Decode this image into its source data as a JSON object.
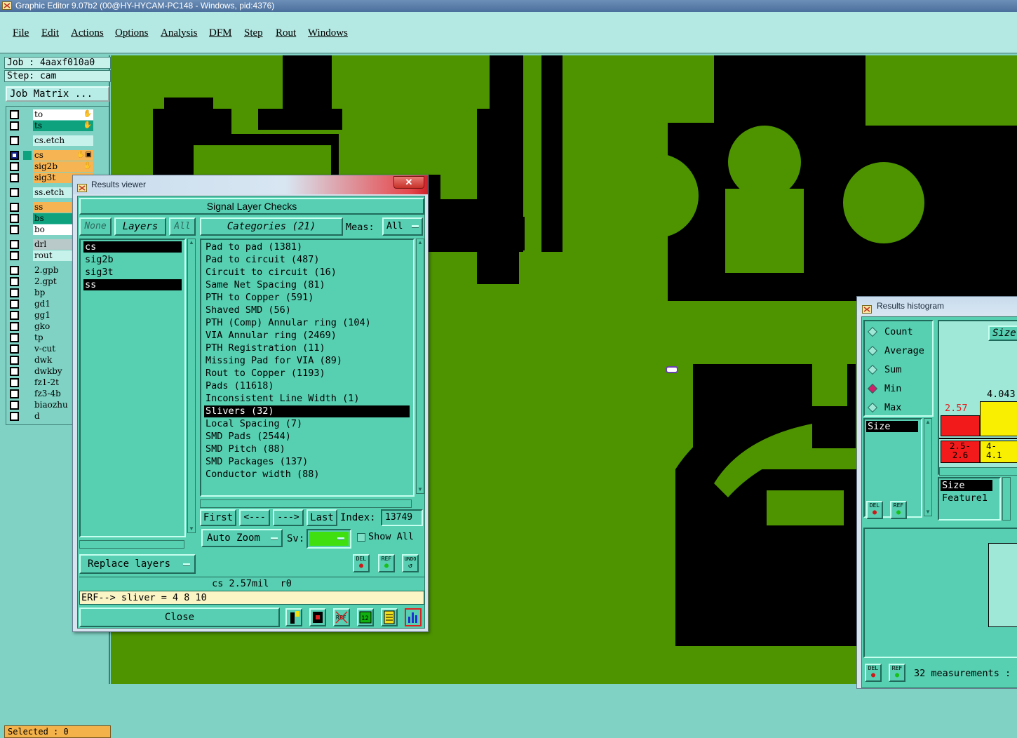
{
  "window": {
    "title": "Graphic Editor 9.07b2 (00@HY-HYCAM-PC148 - Windows, pid:4376)"
  },
  "menu": [
    "File",
    "Edit",
    "Actions",
    "Options",
    "Analysis",
    "DFM",
    "Step",
    "Rout",
    "Windows"
  ],
  "left": {
    "job": "Job : 4aaxf010a0",
    "step": "Step: cam",
    "job_matrix": "Job Matrix ...",
    "selected": "Selected : 0",
    "layers": [
      {
        "name": "to",
        "color": "#ffffff",
        "mark": "✋"
      },
      {
        "name": "ts",
        "color": "#0fa27e",
        "mark": "✋"
      },
      {
        "name": "cs.etch",
        "color": "#c7f2ec",
        "mark": ""
      },
      {
        "name": "cs",
        "color": "#f7b452",
        "mark": "✋▣",
        "selected": true
      },
      {
        "name": "sig2b",
        "color": "#f7b452",
        "mark": "✋"
      },
      {
        "name": "sig3t",
        "color": "#f7b452",
        "mark": ""
      },
      {
        "name": "ss.etch",
        "color": "#c7f2ec",
        "mark": ""
      },
      {
        "name": "ss",
        "color": "#f7b452",
        "mark": ""
      },
      {
        "name": "bs",
        "color": "#0fa27e",
        "mark": ""
      },
      {
        "name": "bo",
        "color": "#ffffff",
        "mark": ""
      },
      {
        "name": "drl",
        "color": "#b9c9c9",
        "mark": ""
      },
      {
        "name": "rout",
        "color": "#c7f2ec",
        "mark": ""
      },
      {
        "name": "2.gpb",
        "color": "#7fd2c4",
        "mark": ""
      },
      {
        "name": "2.gpt",
        "color": "#7fd2c4",
        "mark": ""
      },
      {
        "name": "bp",
        "color": "#7fd2c4",
        "mark": ""
      },
      {
        "name": "gd1",
        "color": "#7fd2c4",
        "mark": ""
      },
      {
        "name": "gg1",
        "color": "#7fd2c4",
        "mark": ""
      },
      {
        "name": "gko",
        "color": "#7fd2c4",
        "mark": ""
      },
      {
        "name": "tp",
        "color": "#7fd2c4",
        "mark": ""
      },
      {
        "name": "v-cut",
        "color": "#7fd2c4",
        "mark": ""
      },
      {
        "name": "dwk",
        "color": "#7fd2c4",
        "mark": ""
      },
      {
        "name": "dwkby",
        "color": "#7fd2c4",
        "mark": ""
      },
      {
        "name": "fz1-2t",
        "color": "#7fd2c4",
        "mark": ""
      },
      {
        "name": "fz3-4b",
        "color": "#7fd2c4",
        "mark": ""
      },
      {
        "name": "biaozhu",
        "color": "#7fd2c4",
        "mark": ""
      },
      {
        "name": "d",
        "color": "#7fd2c4",
        "mark": ""
      }
    ]
  },
  "viewer": {
    "title": "Results viewer",
    "close_x": "✕",
    "header": "Signal Layer Checks",
    "none_btn": "None",
    "layers_btn": "Layers",
    "all_btn": "All",
    "categories_btn": "Categories (21)",
    "meas_label": "Meas:",
    "meas_value": "All",
    "layers": [
      {
        "name": "cs",
        "selected": true
      },
      {
        "name": "sig2b",
        "selected": false
      },
      {
        "name": "sig3t",
        "selected": false
      },
      {
        "name": "ss",
        "selected": true
      }
    ],
    "categories": [
      {
        "label": "Pad to pad (1381)",
        "selected": false
      },
      {
        "label": "Pad to circuit (487)",
        "selected": false
      },
      {
        "label": "Circuit to circuit (16)",
        "selected": false
      },
      {
        "label": "Same Net Spacing (81)",
        "selected": false
      },
      {
        "label": "PTH to Copper (591)",
        "selected": false
      },
      {
        "label": "Shaved SMD (56)",
        "selected": false
      },
      {
        "label": "PTH (Comp) Annular ring (104)",
        "selected": false
      },
      {
        "label": "VIA Annular ring (2469)",
        "selected": false
      },
      {
        "label": "PTH Registration (11)",
        "selected": false
      },
      {
        "label": "Missing Pad for VIA (89)",
        "selected": false
      },
      {
        "label": "Rout to Copper (1193)",
        "selected": false
      },
      {
        "label": "Pads (11618)",
        "selected": false
      },
      {
        "label": "Inconsistent Line Width (1)",
        "selected": false
      },
      {
        "label": "Slivers (32)",
        "selected": true
      },
      {
        "label": "Local Spacing (7)",
        "selected": false
      },
      {
        "label": "SMD Pads (2544)",
        "selected": false
      },
      {
        "label": "SMD Pitch (88)",
        "selected": false
      },
      {
        "label": "SMD Packages (137)",
        "selected": false
      },
      {
        "label": "Conductor width (88)",
        "selected": false
      }
    ],
    "first_btn": "First",
    "prev_btn": "<---",
    "next_btn": "--->",
    "last_btn": "Last",
    "index_label": "Index:",
    "index_value": "13749",
    "auto_zoom": "Auto Zoom",
    "sv_label": "Sv:",
    "show_all": "Show All",
    "replace_layers": "Replace layers",
    "del": "DEL",
    "ref": "REF",
    "undo": "UNDO",
    "status": "cs 2.57mil  r0",
    "erf": "ERF--> sliver = 4 8 10",
    "close_btn": "Close"
  },
  "histogram": {
    "title": "Results histogram",
    "modes": [
      {
        "label": "Count",
        "on": false
      },
      {
        "label": "Average",
        "on": false
      },
      {
        "label": "Sum",
        "on": false
      },
      {
        "label": "Min",
        "on": true
      },
      {
        "label": "Max",
        "on": false
      }
    ],
    "size_header": "Size",
    "list_item": "Size",
    "bar1_value": "2.57",
    "bar2_value": "4.043",
    "bar1_range": "2.5-\n2.6",
    "bar2_range": "4-\n4.1",
    "size_sel": "Size",
    "feature": "Feature1",
    "del": "DEL",
    "ref": "REF",
    "measurements": "32 measurements :"
  }
}
